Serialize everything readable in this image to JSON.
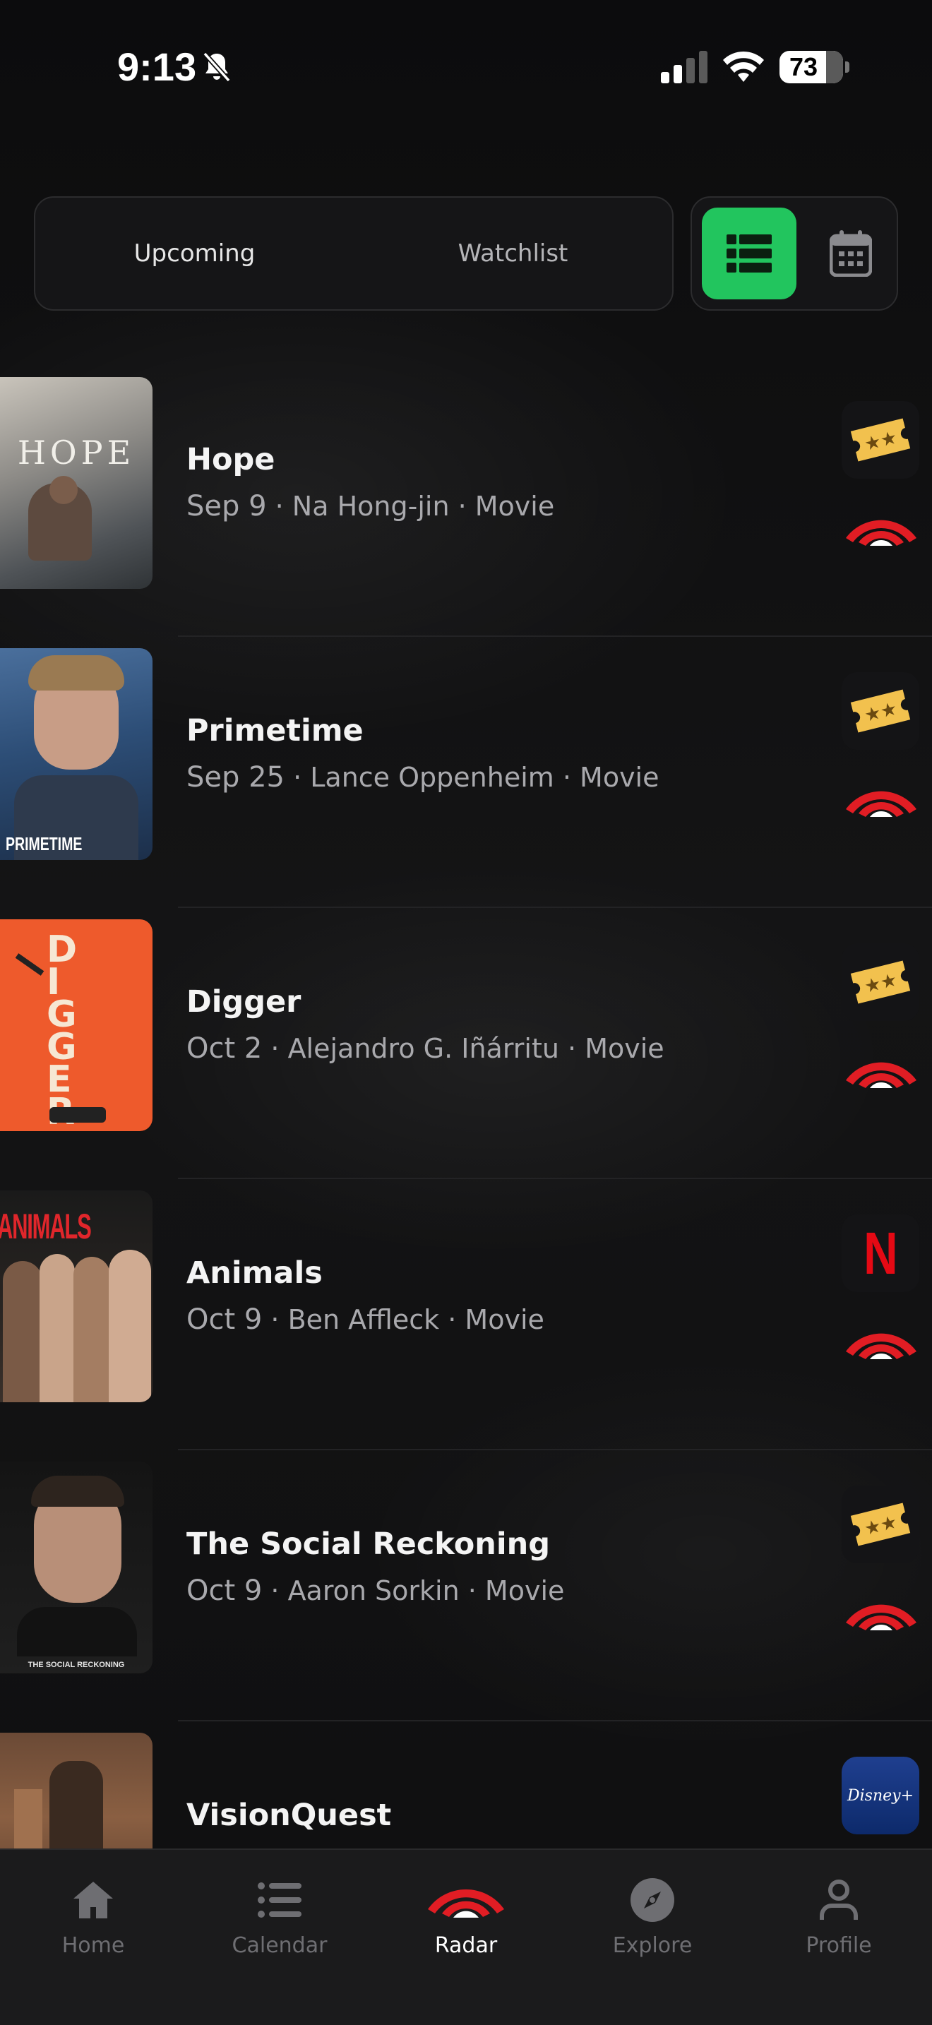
{
  "status_bar": {
    "time": "9:13",
    "battery": "73"
  },
  "segment": {
    "tabs": [
      {
        "label": "Upcoming",
        "active": true
      },
      {
        "label": "Watchlist",
        "active": false
      }
    ],
    "view_modes": [
      "list-view",
      "calendar-view"
    ],
    "selected_view": "list-view",
    "accent_color": "#22c55e"
  },
  "releases": [
    {
      "title": "Hope",
      "date": "Sep 9",
      "detail": " · Na Hong-jin · Movie",
      "poster_text": "HOPE",
      "provider": "ticket"
    },
    {
      "title": "Primetime",
      "date": "Sep 25",
      "detail": " · Lance Oppenheim · Movie",
      "poster_text": "PRIMETIME",
      "provider": "ticket"
    },
    {
      "title": "Digger",
      "date": "Oct 2",
      "detail": " · Alejandro G. Iñárritu · Movie",
      "poster_text": "DIGGER",
      "provider": "ticket"
    },
    {
      "title": "Animals",
      "date": "Oct 9",
      "detail": " · Ben Affleck · Movie",
      "poster_text": "ANIMALS",
      "provider": "netflix"
    },
    {
      "title": "The Social Reckoning",
      "date": "Oct 9",
      "detail": " · Aaron Sorkin · Movie",
      "poster_text": "THE SOCIAL RECKONING",
      "provider": "ticket"
    },
    {
      "title": "VisionQuest",
      "date": "",
      "detail": "",
      "poster_text": "",
      "provider": "disney-plus"
    }
  ],
  "provider_labels": {
    "netflix": "N",
    "disney": "Disney+"
  },
  "tabbar": {
    "items": [
      {
        "label": "Home",
        "icon": "home-icon",
        "active": false
      },
      {
        "label": "Calendar",
        "icon": "list-icon",
        "active": false
      },
      {
        "label": "Radar",
        "icon": "radar-icon",
        "active": true
      },
      {
        "label": "Explore",
        "icon": "compass-icon",
        "active": false
      },
      {
        "label": "Profile",
        "icon": "person-icon",
        "active": false
      }
    ]
  },
  "colors": {
    "radar_red": "#e11d24",
    "ticket_gold": "#f2c14e"
  }
}
